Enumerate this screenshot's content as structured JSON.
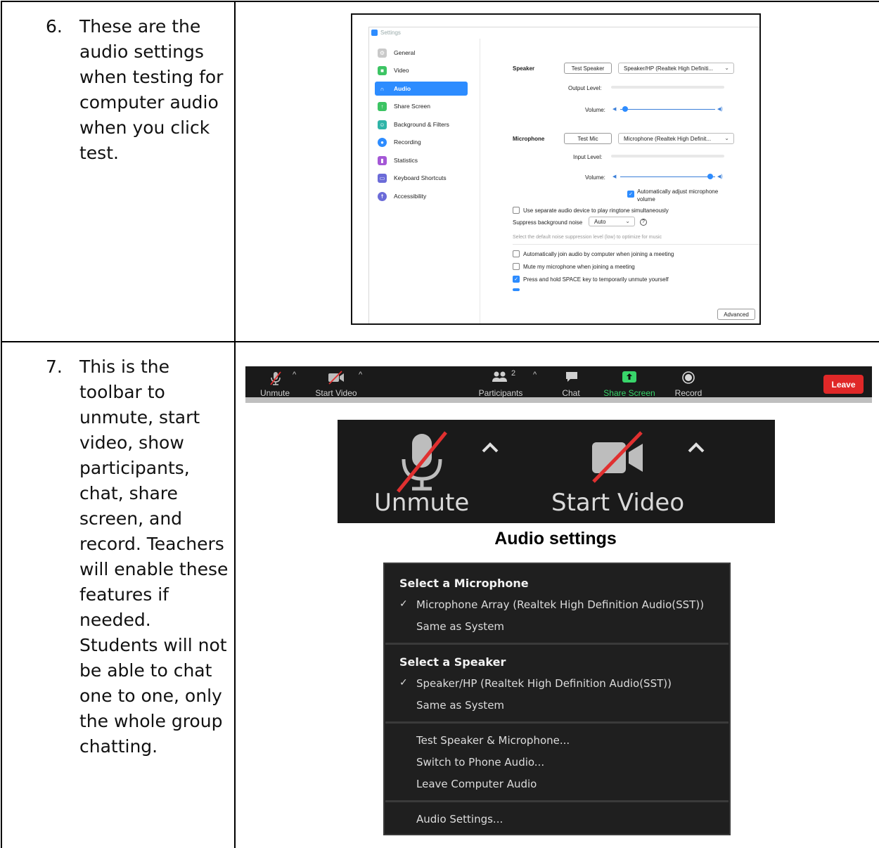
{
  "rows": [
    {
      "num": "6.",
      "text": "These are the audio settings when testing for computer audio when you click test."
    },
    {
      "num": "7.",
      "text": "This is the toolbar to unmute, start video, show participants, chat, share screen, and record. Teachers will enable these features if needed. Students will not be able to chat one to one, only the whole group chatting."
    }
  ],
  "settings": {
    "title": "Settings",
    "nav": [
      "General",
      "Video",
      "Audio",
      "Share Screen",
      "Background & Filters",
      "Recording",
      "Statistics",
      "Keyboard Shortcuts",
      "Accessibility"
    ],
    "active_nav": "Audio",
    "speaker_label": "Speaker",
    "test_speaker": "Test Speaker",
    "speaker_device": "Speaker/HP (Realtek High Definiti...",
    "output_level": "Output Level:",
    "volume": "Volume:",
    "microphone_label": "Microphone",
    "test_mic": "Test Mic",
    "mic_device": "Microphone (Realtek High Definit...",
    "input_level": "Input Level:",
    "auto_adjust": "Automatically adjust microphone volume",
    "separate_device": "Use separate audio device to play ringtone simultaneously",
    "suppress_label": "Suppress background noise",
    "suppress_value": "Auto",
    "suppress_hint": "Select the default noise suppression level (low) to optimize for music",
    "auto_join": "Automatically join audio by computer when joining a meeting",
    "mute_join": "Mute my microphone when joining a meeting",
    "press_space": "Press and hold SPACE key to temporarily unmute yourself",
    "advanced": "Advanced",
    "speaker_volume": 0.05,
    "mic_volume": 0.95,
    "checks": {
      "auto_adjust": true,
      "separate_device": false,
      "auto_join": false,
      "mute_join": false,
      "press_space": true
    }
  },
  "toolbar": {
    "unmute": "Unmute",
    "start_video": "Start Video",
    "participants": "Participants",
    "participants_count": "2",
    "chat": "Chat",
    "share_screen": "Share Screen",
    "record": "Record",
    "leave": "Leave"
  },
  "zoom": {
    "unmute": "Unmute",
    "start_video": "Start Video"
  },
  "caption": "Audio settings",
  "audio_menu": {
    "mic_header": "Select a Microphone",
    "mic_selected": "Microphone Array (Realtek High Definition Audio(SST))",
    "mic_same": "Same as System",
    "spk_header": "Select a Speaker",
    "spk_selected": "Speaker/HP (Realtek High Definition Audio(SST))",
    "spk_same": "Same as System",
    "test": "Test Speaker & Microphone...",
    "switch_phone": "Switch to Phone Audio...",
    "leave_audio": "Leave Computer Audio",
    "audio_settings": "Audio Settings..."
  },
  "colors": {
    "zoom_blue": "#2d8cff",
    "leave_red": "#e02828",
    "share_green": "#38d46a",
    "mute_slash": "#e03030"
  }
}
